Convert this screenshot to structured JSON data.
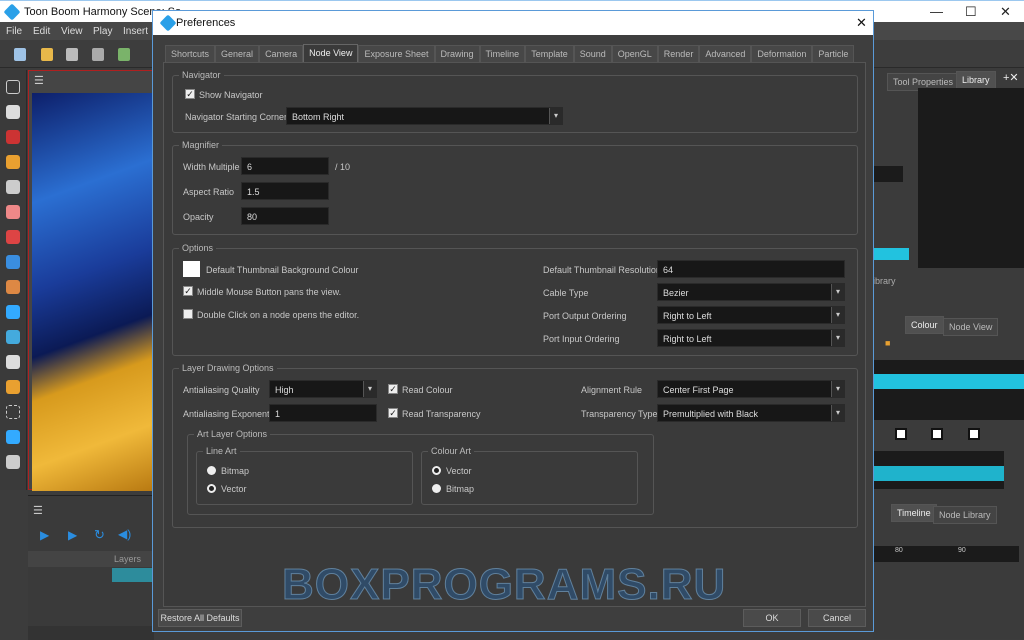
{
  "app": {
    "title": "Toon Boom Harmony Scene: So...",
    "menu": [
      "File",
      "Edit",
      "View",
      "Play",
      "Insert"
    ]
  },
  "right_panel": {
    "tabs_top": [
      "Tool Properties",
      "Library"
    ],
    "library_text": "ibrary",
    "tabs_mid": [
      "Colour",
      "Node View"
    ],
    "tabs_bottom": [
      "Timeline",
      "Node Library"
    ],
    "ruler": [
      "80",
      "90"
    ],
    "accent": "#22c2df"
  },
  "timeline": {
    "layers_label": "Layers"
  },
  "dialog": {
    "title": "Preferences",
    "tabs": [
      "Shortcuts",
      "General",
      "Camera",
      "Node View",
      "Exposure Sheet",
      "Drawing",
      "Timeline",
      "Template",
      "Sound",
      "OpenGL",
      "Render",
      "Advanced",
      "Deformation",
      "Particle"
    ],
    "active_tab": "Node View",
    "navigator": {
      "title": "Navigator",
      "show_navigator": "Show Navigator",
      "show_checked": true,
      "corner_label": "Navigator Starting Corner",
      "corner_value": "Bottom Right"
    },
    "magnifier": {
      "title": "Magnifier",
      "width_label": "Width Multiple",
      "width_value": "6",
      "width_suffix": "/ 10",
      "aspect_label": "Aspect Ratio",
      "aspect_value": "1.5",
      "opacity_label": "Opacity",
      "opacity_value": "80"
    },
    "options": {
      "title": "Options",
      "bg_colour": "Default Thumbnail Background Colour",
      "middle_mouse": "Middle Mouse Button pans the view.",
      "middle_checked": true,
      "double_click": "Double Click on a node opens the editor.",
      "double_checked": false,
      "thumb_res_label": "Default Thumbnail Resolution",
      "thumb_res_value": "64",
      "cable_label": "Cable Type",
      "cable_value": "Bezier",
      "out_label": "Port Output Ordering",
      "out_value": "Right to Left",
      "in_label": "Port Input Ordering",
      "in_value": "Right to Left"
    },
    "layer": {
      "title": "Layer Drawing Options",
      "aa_q_label": "Antialiasing Quality",
      "aa_q_value": "High",
      "aa_e_label": "Antialiasing Exponent",
      "aa_e_value": "1",
      "read_colour": "Read Colour",
      "read_trans": "Read Transparency",
      "align_label": "Alignment Rule",
      "align_value": "Center First Page",
      "trans_label": "Transparency Type",
      "trans_value": "Premultiplied with Black",
      "art_title": "Art Layer Options",
      "line_art": "Line Art",
      "line_opts": [
        "Bitmap",
        "Vector"
      ],
      "line_selected": "Vector",
      "colour_art": "Colour Art",
      "colour_opts": [
        "Vector",
        "Bitmap"
      ],
      "colour_selected": "Vector"
    },
    "buttons": {
      "restore": "Restore All Defaults",
      "ok": "OK",
      "cancel": "Cancel"
    }
  },
  "watermark": "BOXPROGRAMS.RU"
}
